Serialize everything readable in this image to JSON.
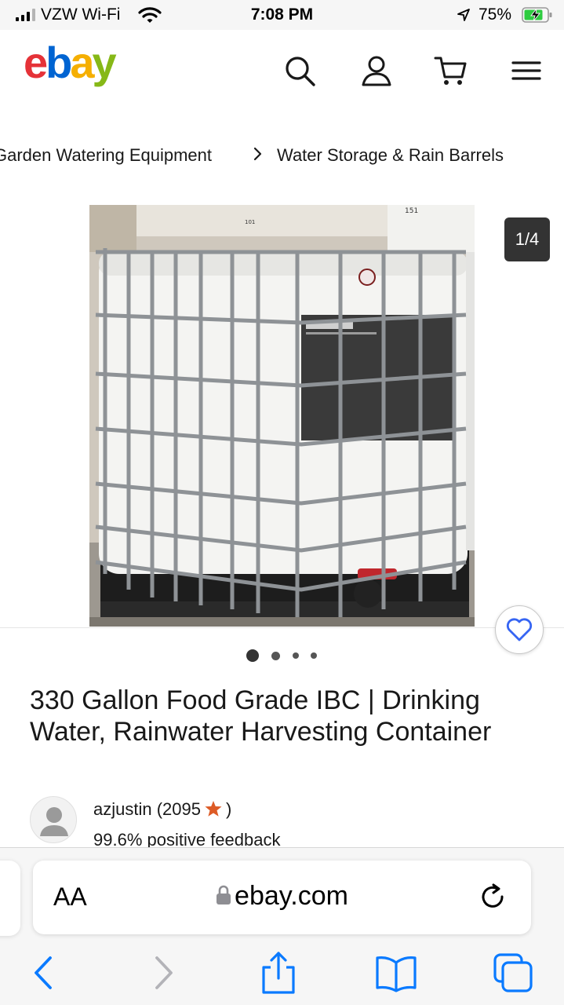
{
  "status_bar": {
    "carrier": "VZW Wi-Fi",
    "time": "7:08 PM",
    "battery_percent": "75%"
  },
  "header": {
    "logo_letters": [
      "e",
      "b",
      "a",
      "y"
    ],
    "logo_colors": [
      "#e53238",
      "#0064d2",
      "#f5af02",
      "#86b817"
    ],
    "icons": [
      "search-icon",
      "account-icon",
      "cart-icon",
      "menu-icon"
    ]
  },
  "breadcrumb": {
    "items": [
      "Garden Watering Equipment",
      "Water Storage & Rain Barrels"
    ],
    "separator_icon": "chevron-right-icon"
  },
  "gallery": {
    "counter": "1/4",
    "dots_count": 4,
    "active_dot": 0,
    "favorite_icon": "heart-icon"
  },
  "listing": {
    "title": "330 Gallon Food Grade IBC | Drinking Water, Rainwater Harvesting Container"
  },
  "seller": {
    "name_line": "azjustin (2095",
    "rating_close": ")",
    "feedback": "99.6% positive feedback",
    "star_color": "#dd5b26"
  },
  "safari": {
    "text_size_label": "AA",
    "url": "ebay.com",
    "toolbar": [
      "back-icon",
      "forward-icon",
      "share-icon",
      "bookmarks-icon",
      "tabs-icon"
    ],
    "accent": "#0a7aff"
  }
}
